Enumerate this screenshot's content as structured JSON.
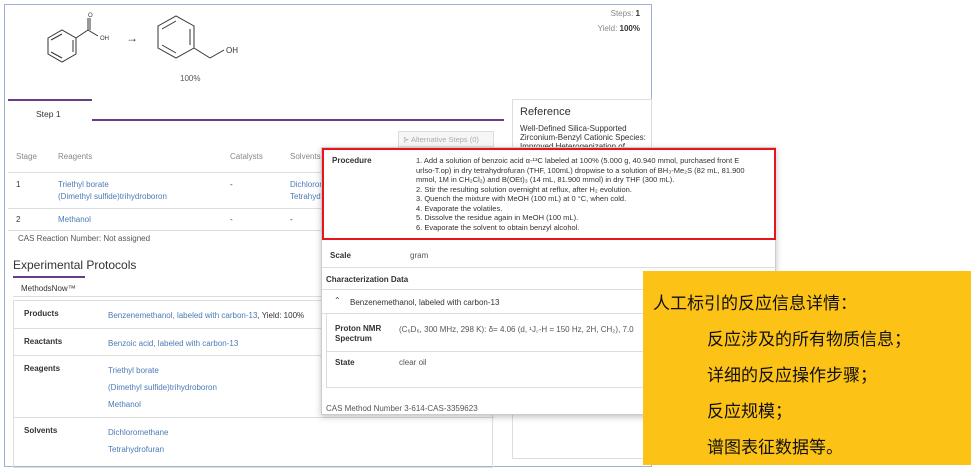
{
  "reaction": {
    "reactant_label": "OH",
    "product_label": "OH",
    "arrow": "→",
    "product_yield": "100%",
    "steps_label": "Steps:",
    "steps_value": "1",
    "yield_label": "Yield:",
    "yield_value": "100%"
  },
  "step_tab": "Step 1",
  "alternative_steps": "Alternative Steps (0)",
  "stage_table": {
    "headers": [
      "Stage",
      "Reagents",
      "Catalysts",
      "Solvents"
    ],
    "rows": [
      {
        "stage": "1",
        "reagents": [
          "Triethyl borate",
          "(Dimethyl sulfide)trihydroboron"
        ],
        "catalysts": "-",
        "solvents": [
          "Dichloror",
          "Tetrahyd"
        ]
      },
      {
        "stage": "2",
        "reagents": [
          "Methanol"
        ],
        "catalysts": "-",
        "solvents": [
          "-"
        ]
      }
    ]
  },
  "cas_reaction_number": "CAS Reaction Number: Not assigned",
  "reference": {
    "title": "Reference",
    "text": "Well-Defined Silica-Supported Zirconium-Benzyl Cationic Species: Improved Heterogenization of"
  },
  "experimental": {
    "title": "Experimental Protocols",
    "tab": "MethodsNow™",
    "rows": [
      {
        "label": "Products",
        "values": [
          "Benzenemethanol, labeled with carbon-13"
        ],
        "suffix": ", Yield: 100%"
      },
      {
        "label": "Reactants",
        "values": [
          "Benzoic acid, labeled with carbon-13"
        ]
      },
      {
        "label": "Reagents",
        "values": [
          "Triethyl borate",
          "(Dimethyl sulfide)trihydroboron",
          "Methanol"
        ]
      },
      {
        "label": "Solvents",
        "values": [
          "Dichloromethane",
          "Tetrahydrofuran"
        ]
      }
    ]
  },
  "popup": {
    "procedure_label": "Procedure",
    "procedure_steps": [
      "1. Add a solution of benzoic acid α-¹³C labeled at 100% (5.000 g, 40.940 mmol, purchased front E",
      "    urlso-T.op) in dry tetrahydrofuran (THF, 100mL) dropwise to a solution of BH₃-Me₂S (82 mL, 81.900",
      "    mmol, 1M in CH₂Cl₂) and B(OEt)₃ (14 mL, 81.900 mmol) in dry THF (300 mL).",
      "2. Stir the resulting solution overnight at reflux, after H₂ evolution.",
      "3. Quench the mixture with MeOH (100 mL) at 0 °C, when cold.",
      "4. Evaporate the volatiles.",
      "5. Dissolve the residue again in MeOH (100 mL).",
      "6. Evaporate the solvent to obtain benzyl alcohol."
    ],
    "scale_label": "Scale",
    "scale_value": "gram",
    "char_label": "Characterization Data",
    "compound": "Benzenemethanol, labeled with carbon-13",
    "nmr_label": "Proton NMR Spectrum",
    "nmr_value": "(C₆D₆, 300 MHz, 298 K): δ= 4.06 (d, ¹J꜀-H = 150 Hz, 2H, CH₂), 7.0",
    "state_label": "State",
    "state_value": "clear oil",
    "cas_method": "CAS Method Number 3-614-CAS-3359623"
  },
  "callout": {
    "title": "人工标引的反应信息详情：",
    "lines": [
      "反应涉及的所有物质信息；",
      "详细的反应操作步骤；",
      "反应规模；",
      "谱图表征数据等。"
    ]
  }
}
